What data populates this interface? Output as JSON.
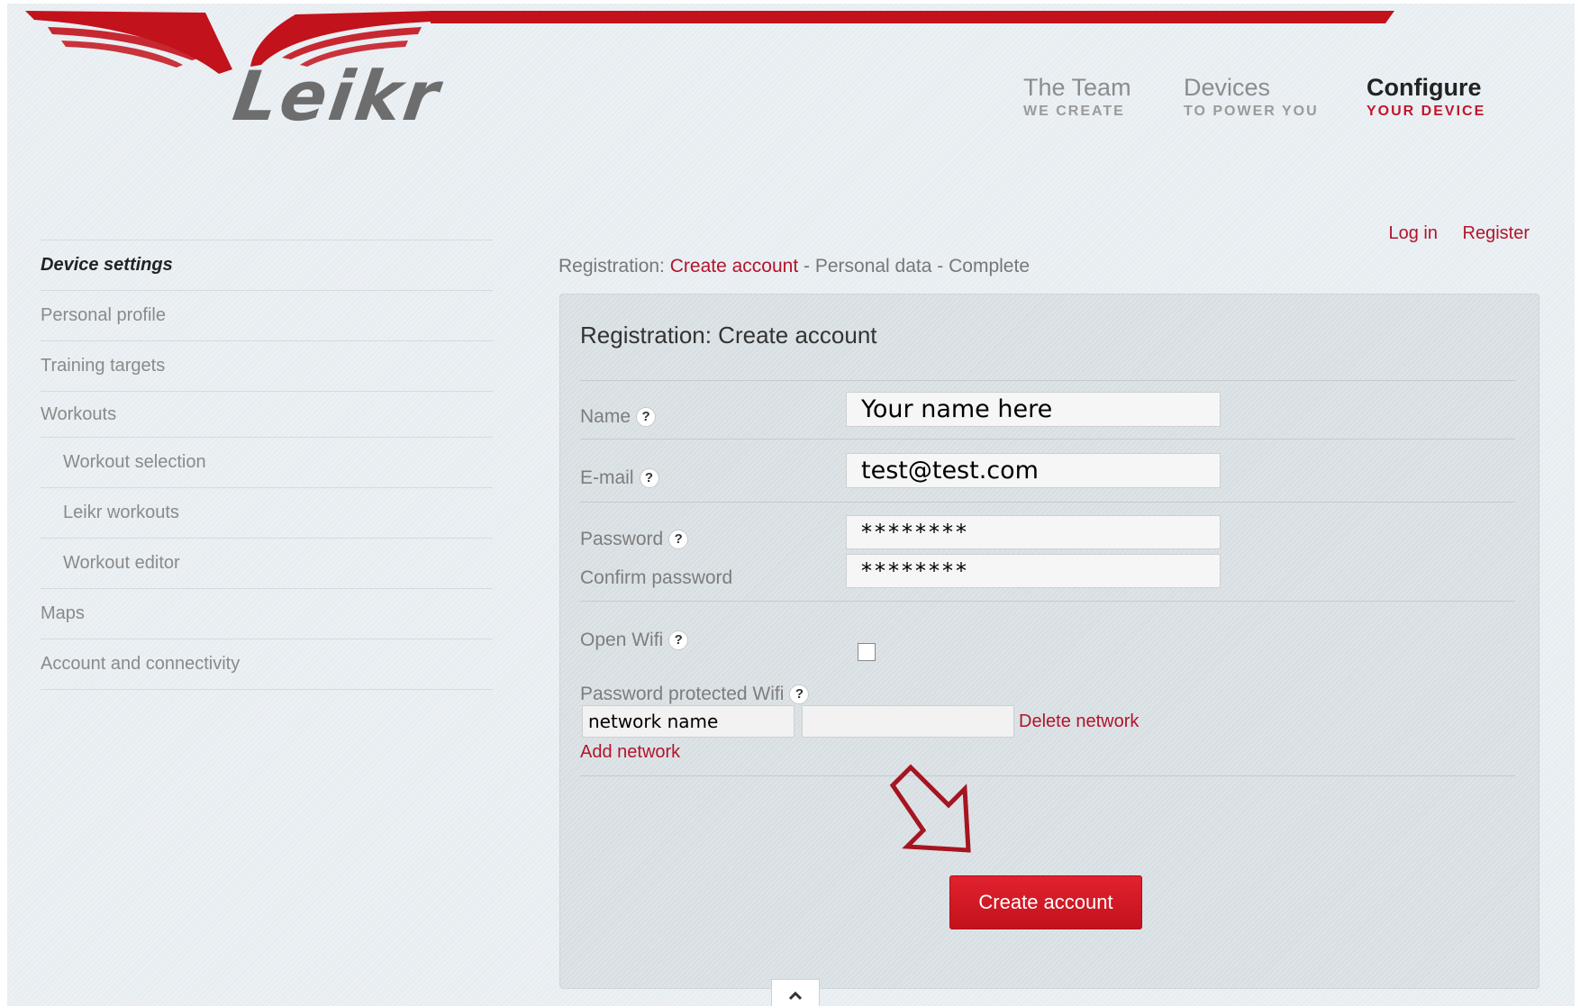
{
  "brand": {
    "logo_text": "Leikr",
    "accent_color": "#c2162d"
  },
  "top_nav": [
    {
      "main": "The Team",
      "sub": "WE CREATE"
    },
    {
      "main": "Devices",
      "sub": "TO POWER YOU"
    },
    {
      "main": "Configure",
      "sub": "YOUR DEVICE"
    }
  ],
  "auth": {
    "login": "Log in",
    "register": "Register"
  },
  "sidebar": {
    "items": [
      "Device settings",
      "Personal profile",
      "Training targets",
      "Workouts",
      "Workout selection",
      "Leikr workouts",
      "Workout editor",
      "Maps",
      "Account and connectivity"
    ]
  },
  "breadcrumb": {
    "prefix": "Registration:",
    "current": "Create account",
    "sep1": "-",
    "step2": "Personal data",
    "sep2": "-",
    "step3": "Complete"
  },
  "form": {
    "title": "Registration: Create account",
    "help_glyph": "?",
    "name_label": "Name",
    "name_value": "Your name here",
    "email_label": "E-mail",
    "email_value": "test@test.com",
    "password_label": "Password",
    "password_value": "********",
    "confirm_label": "Confirm password",
    "confirm_value": "********",
    "open_wifi_label": "Open Wifi",
    "open_wifi_checked": false,
    "protected_wifi_label": "Password protected Wifi",
    "network_name_value": "network name",
    "network_password_value": "",
    "delete_network": "Delete network",
    "add_network": "Add network",
    "submit": "Create account"
  },
  "scroll_icon": "chevron-up-icon"
}
